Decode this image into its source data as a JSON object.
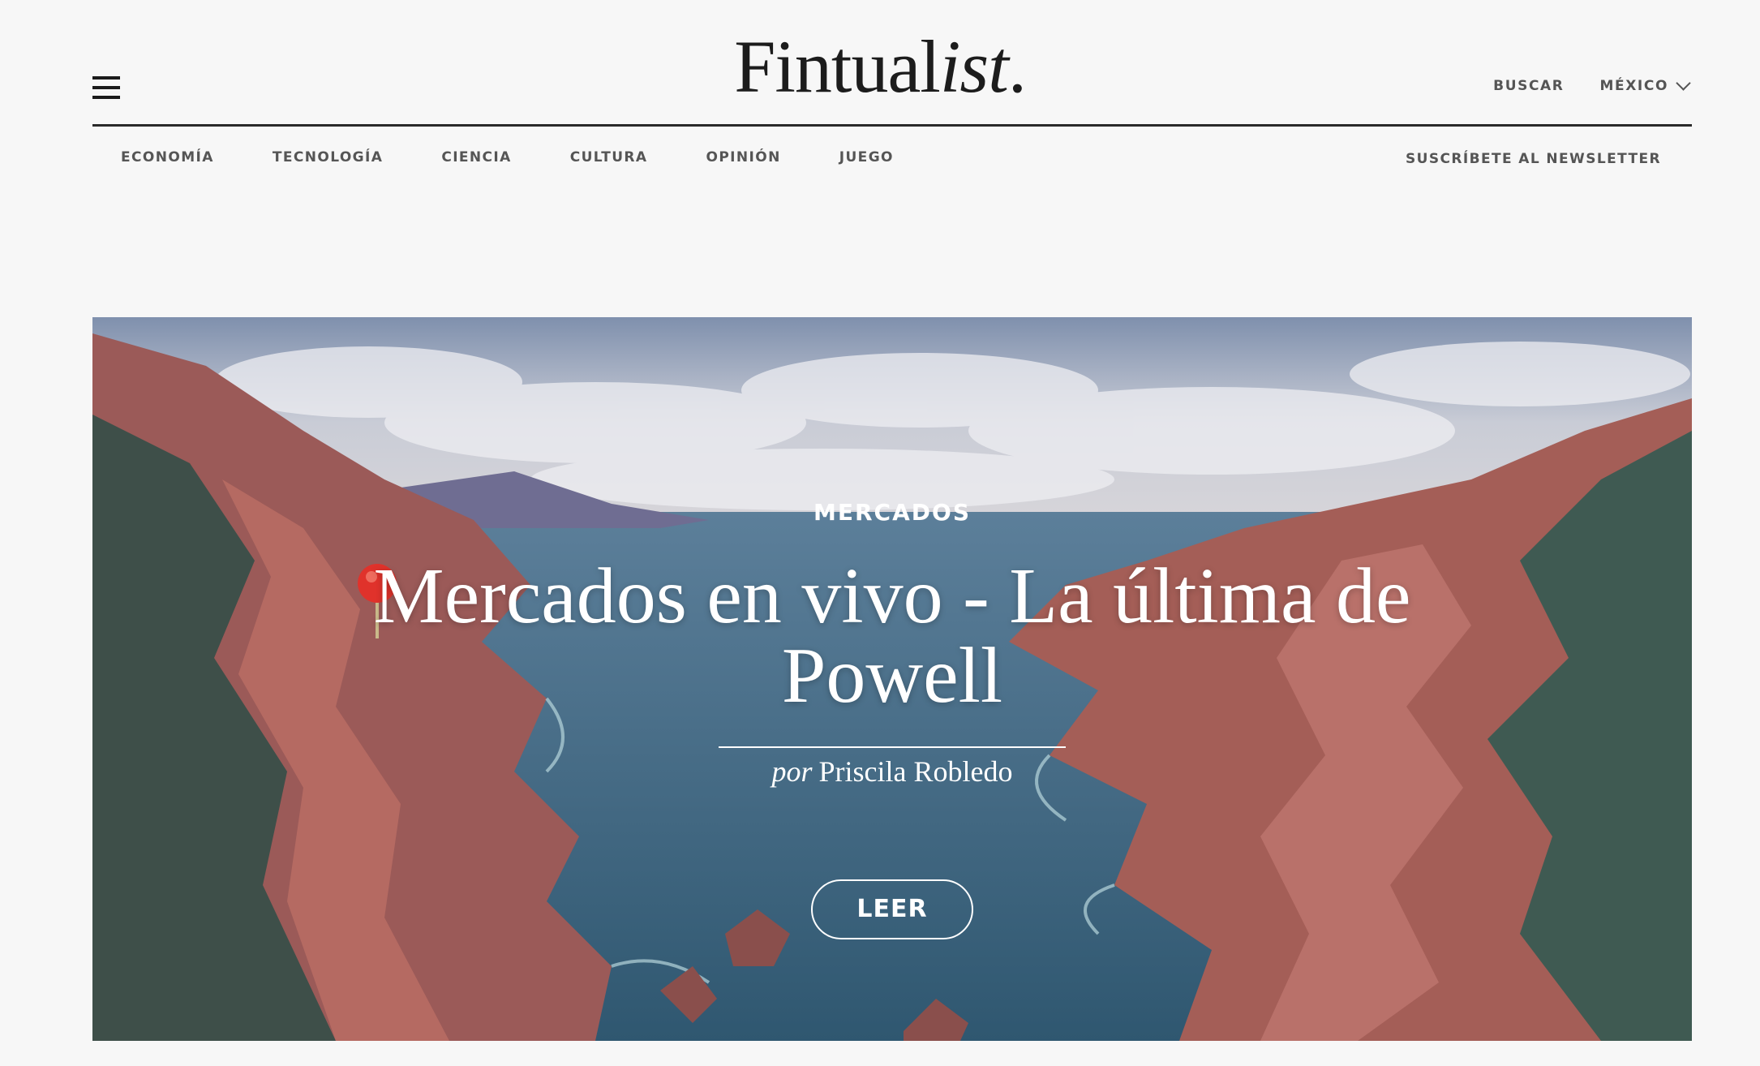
{
  "header": {
    "logo_main": "Fintual",
    "logo_italic": "ist",
    "logo_dot": ".",
    "search_label": "BUSCAR",
    "country_label": "MÉXICO"
  },
  "nav": {
    "items": [
      "ECONOMÍA",
      "TECNOLOGÍA",
      "CIENCIA",
      "CULTURA",
      "OPINIÓN",
      "JUEGO"
    ],
    "newsletter_label": "SUSCRÍBETE AL NEWSLETTER"
  },
  "hero": {
    "category": "MERCADOS",
    "title": "Mercados en vivo - La última de Powell",
    "byline_prefix": "por",
    "author": "Priscila Robledo",
    "read_label": "LEER"
  },
  "colors": {
    "background": "#f7f7f7",
    "text_dark": "#1c1c1c",
    "nav_text": "#555555",
    "sea": "#3f6077",
    "cliffs": "#a45e57",
    "pin": "#e0322b"
  },
  "icons": [
    "hamburger-menu-icon",
    "chevron-down-icon",
    "pin-icon"
  ]
}
